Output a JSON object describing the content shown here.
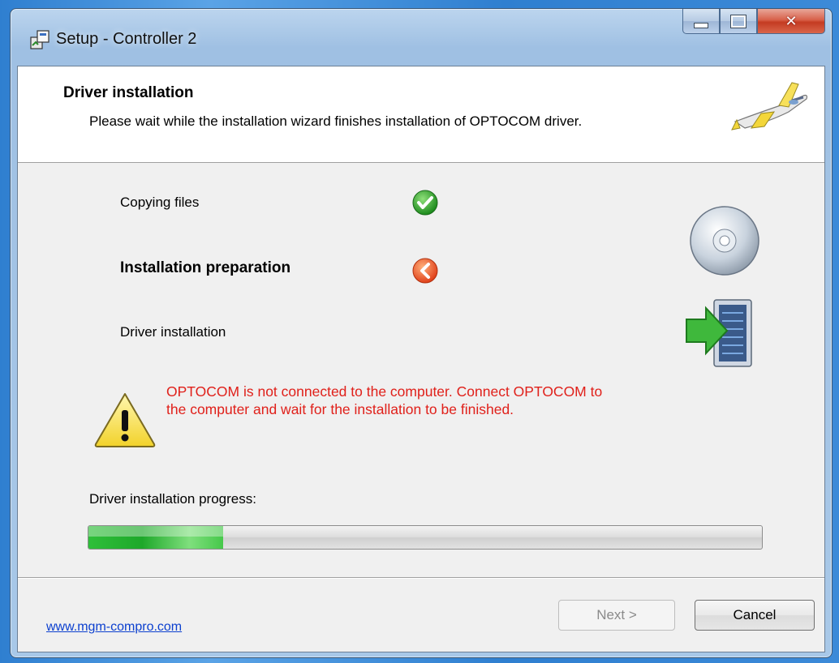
{
  "window": {
    "title": "Setup - Controller 2",
    "controls": {
      "minimize": "minimize",
      "maximize": "maximize",
      "close": "close"
    }
  },
  "header": {
    "title": "Driver installation",
    "subtitle": "Please wait while the installation wizard finishes installation of OPTOCOM driver.",
    "logo_icon": "airplane-icon"
  },
  "steps": [
    {
      "label": "Copying files",
      "status": "done",
      "status_icon": "checkmark-icon"
    },
    {
      "label": "Installation preparation",
      "status": "current",
      "status_icon": "arrow-left-icon"
    },
    {
      "label": "Driver installation",
      "status": "pending"
    }
  ],
  "side_icons": [
    "cd-disc-icon",
    "server-install-icon"
  ],
  "warning": {
    "icon": "warning-icon",
    "text": "OPTOCOM is not connected to the computer. Connect OPTOCOM to the computer and wait for the installation to be finished.",
    "color": "#e0201a"
  },
  "progress": {
    "label": "Driver installation progress:",
    "value": 0.2
  },
  "footer": {
    "link": "www.mgm-compro.com",
    "next_label": "Next >",
    "next_enabled": false,
    "cancel_label": "Cancel"
  }
}
